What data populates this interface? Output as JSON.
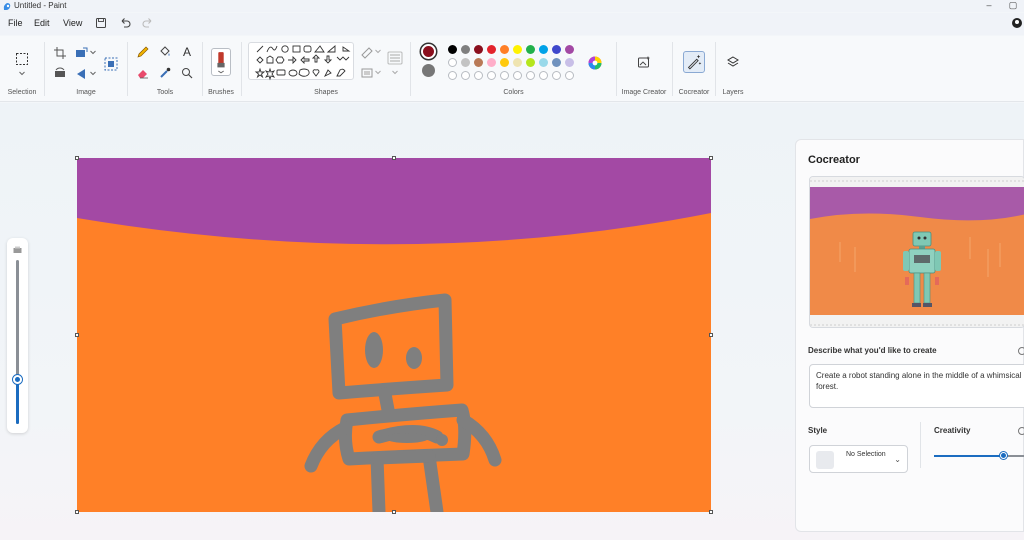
{
  "window": {
    "title": "Untitled - Paint"
  },
  "menu": {
    "file": "File",
    "edit": "Edit",
    "view": "View"
  },
  "ribbon": {
    "groups": {
      "selection": "Selection",
      "image": "Image",
      "tools": "Tools",
      "brushes": "Brushes",
      "shapes": "Shapes",
      "colors": "Colors",
      "image_creator": "Image Creator",
      "cocreator": "Cocreator",
      "layers": "Layers"
    },
    "text_tool_glyph": "A",
    "color1": "#8a0f1d",
    "color2": "#777777",
    "palette_row1": [
      "#000000",
      "#7f7f7f",
      "#8a0f1d",
      "#e3232c",
      "#ff7f27",
      "#fff200",
      "#22b14c",
      "#00a2e8",
      "#3f48cc",
      "#a349a4"
    ]
  },
  "canvas": {
    "background": "#ff8027",
    "sky": "#a349a4",
    "ink": "#7f7f7f"
  },
  "cocreator": {
    "title": "Cocreator",
    "prompt_label": "Describe what you'd like to create",
    "prompt_text": "Create a robot standing alone in the middle of a whimsical forest.",
    "style_label": "Style",
    "style_value": "No Selection",
    "creativity_label": "Creativity",
    "creativity_level": 0.77
  }
}
